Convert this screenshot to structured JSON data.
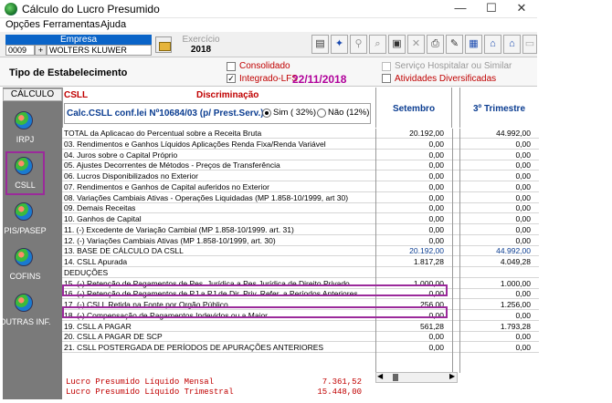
{
  "window": {
    "title": "Cálculo do Lucro Presumido",
    "min": "—",
    "max": "☐",
    "close": "✕"
  },
  "menu": [
    "Opções",
    "Ferramentas",
    "Ajuda"
  ],
  "empresa": {
    "label": "Empresa",
    "code": "0009",
    "name": "WOLTERS KLUWER"
  },
  "exercicio": {
    "label": "Exercício",
    "value": "2018"
  },
  "tipo": {
    "label": "Tipo de Estabelecimento",
    "consolidado": "Consolidado",
    "integrado": "Integrado-LFS",
    "date": "22/11/2018",
    "servico": "Serviço Hospitalar ou Similar",
    "atividades": "Atividades Diversificadas"
  },
  "nav": {
    "header": "CÁLCULO",
    "items": [
      "IRPJ",
      "CSLL",
      "PIS/PASEP",
      "COFINS",
      "OUTRAS INF."
    ]
  },
  "grid": {
    "section": "CSLL",
    "discr": "Discriminação",
    "calc": "Calc.CSLL conf.lei  Nº10684/03 (p/ Prest.Serv.)",
    "sim": "Sim  ( 32%)",
    "nao": "Não  (12%)",
    "col1": "Setembro",
    "col2": "3º Trimestre"
  },
  "rows": [
    {
      "d": "TOTAL da Aplicacao do Percentual sobre a Receita Bruta",
      "v1": "20.192,00",
      "v2": "44.992,00"
    },
    {
      "d": "03. Rendimentos e Ganhos Líquidos Aplicações Renda Fixa/Renda Variável",
      "v1": "0,00",
      "v2": "0,00"
    },
    {
      "d": "04. Juros sobre o Capital Próprio",
      "v1": "0,00",
      "v2": "0,00"
    },
    {
      "d": "05. Ajustes Decorrentes de Métodos - Preços de Transferência",
      "v1": "0,00",
      "v2": "0,00"
    },
    {
      "d": "06. Lucros Disponibilizados no Exterior",
      "v1": "0,00",
      "v2": "0,00"
    },
    {
      "d": "07. Rendimentos e Ganhos de Capital auferidos no Exterior",
      "v1": "0,00",
      "v2": "0,00"
    },
    {
      "d": "08. Variações Cambiais Ativas - Operações Liquidadas (MP 1.858-10/1999, art 30)",
      "v1": "0,00",
      "v2": "0,00"
    },
    {
      "d": "09. Demais Receitas",
      "v1": "0,00",
      "v2": "0,00"
    },
    {
      "d": "10. Ganhos de Capital",
      "v1": "0,00",
      "v2": "0,00"
    },
    {
      "d": "11. (-) Excedente de Variação Cambial (MP 1.858-10/1999. art. 31)",
      "v1": "0,00",
      "v2": "0,00"
    },
    {
      "d": "12. (-) Variações Cambiais Ativas (MP 1.858-10/1999, art. 30)",
      "v1": "0,00",
      "v2": "0,00"
    },
    {
      "d": "13. BASE DE CÁLCULO DA CSLL",
      "v1": "20.192,00",
      "v2": "44.992,00",
      "blue": true
    },
    {
      "d": "14. CSLL Apurada",
      "v1": "1.817,28",
      "v2": "4.049,28"
    },
    {
      "d": "DEDUÇÕES",
      "v1": "",
      "v2": ""
    },
    {
      "d": "15. (-) Retenção de Pagamentos de Pes. Jurídica a Pes.Jurídica de Direito Privado",
      "v1": "1.000,00",
      "v2": "1.000,00"
    },
    {
      "d": "16. (-) Retenção de Pagamentos de PJ a PJ de Dir. Priv. Refer. a Períodos Anteriores",
      "v1": "0,00",
      "v2": "0,00"
    },
    {
      "d": "17. (-) CSLL Retida na Fonte por Orgão Público",
      "v1": "256,00",
      "v2": "1.256,00"
    },
    {
      "d": "18. (-) Compensação de Pagamentos Indevidos ou a Maior",
      "v1": "0,00",
      "v2": "0,00"
    },
    {
      "d": "19. CSLL A PAGAR",
      "v1": "561,28",
      "v2": "1.793,28"
    },
    {
      "d": "20. CSLL A PAGAR DE SCP",
      "v1": "0,00",
      "v2": "0,00"
    },
    {
      "d": "21. CSLL POSTERGADA DE PERÍODOS DE APURAÇÕES ANTERIORES",
      "v1": "0,00",
      "v2": "0,00"
    }
  ],
  "footer": {
    "mensal_label": "Lucro Presumido Líquido Mensal",
    "mensal_value": "7.361,52",
    "trim_label": "Lucro Presumido Líquido Trimestral",
    "trim_value": "15.448,00"
  },
  "colors": {
    "accent": "#0a64c8",
    "highlight": "#9b2a9b",
    "red": "#c00000",
    "blue": "#0b3d91"
  }
}
